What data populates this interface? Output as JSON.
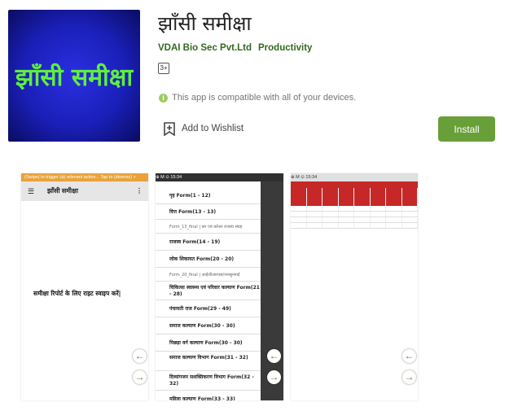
{
  "app": {
    "icon_text": "झाँसी समीक्षा",
    "title": "झाँसी समीक्षा",
    "developer": "VDAI Bio Sec Pvt.Ltd",
    "category": "Productivity",
    "content_rating": "3+",
    "compat_text": "This app is compatible with all of your devices.",
    "wishlist_label": "Add to Wishlist",
    "install_label": "Install"
  },
  "screenshots": {
    "s1": {
      "toast": "(Swipe) to trigger (a) relevant action... Tap to (dismiss) >",
      "appbar_title": "झाँसी समीक्षा",
      "swipe_text": "समीक्षा रिपोर्ट के लिए राइट स्वाइप करें|"
    },
    "s2": {
      "status": "⊕ M ⊙ 15:34",
      "items": [
        "गृह Form(1 - 12)",
        "वित्त Form(13 - 13)",
        "Form_13_final | कर एवं करेत्तर राजस्व संग्रह",
        "राजस्व Form(14 - 19)",
        "लोक शिकायत Form(20 - 20)",
        "Form_20_final | आईजीआरएस/जनसुनवाई",
        "चिकित्सा स्वास्थ्य एवं परिवार कल्याण Form(21 - 28)",
        "पंचायती राज Form(29 - 49)",
        "समाज कल्याण Form(30 - 30)",
        "पिछड़ा वर्ग कल्याण Form(30 - 30)",
        "समाज कल्याण विभाग Form(31 - 32)",
        "दिव्यांगजन सशक्तिकरण विभाग Form(32 - 32)",
        "महिला कल्याण Form(33 - 33)"
      ]
    },
    "s3": {
      "status": "⊕ M ⊙ 15:34"
    }
  },
  "colors": {
    "accent": "#689f38",
    "brand_text": "#33691e",
    "icon_bg": "#1a1fb8",
    "icon_text": "#5ef03a"
  }
}
